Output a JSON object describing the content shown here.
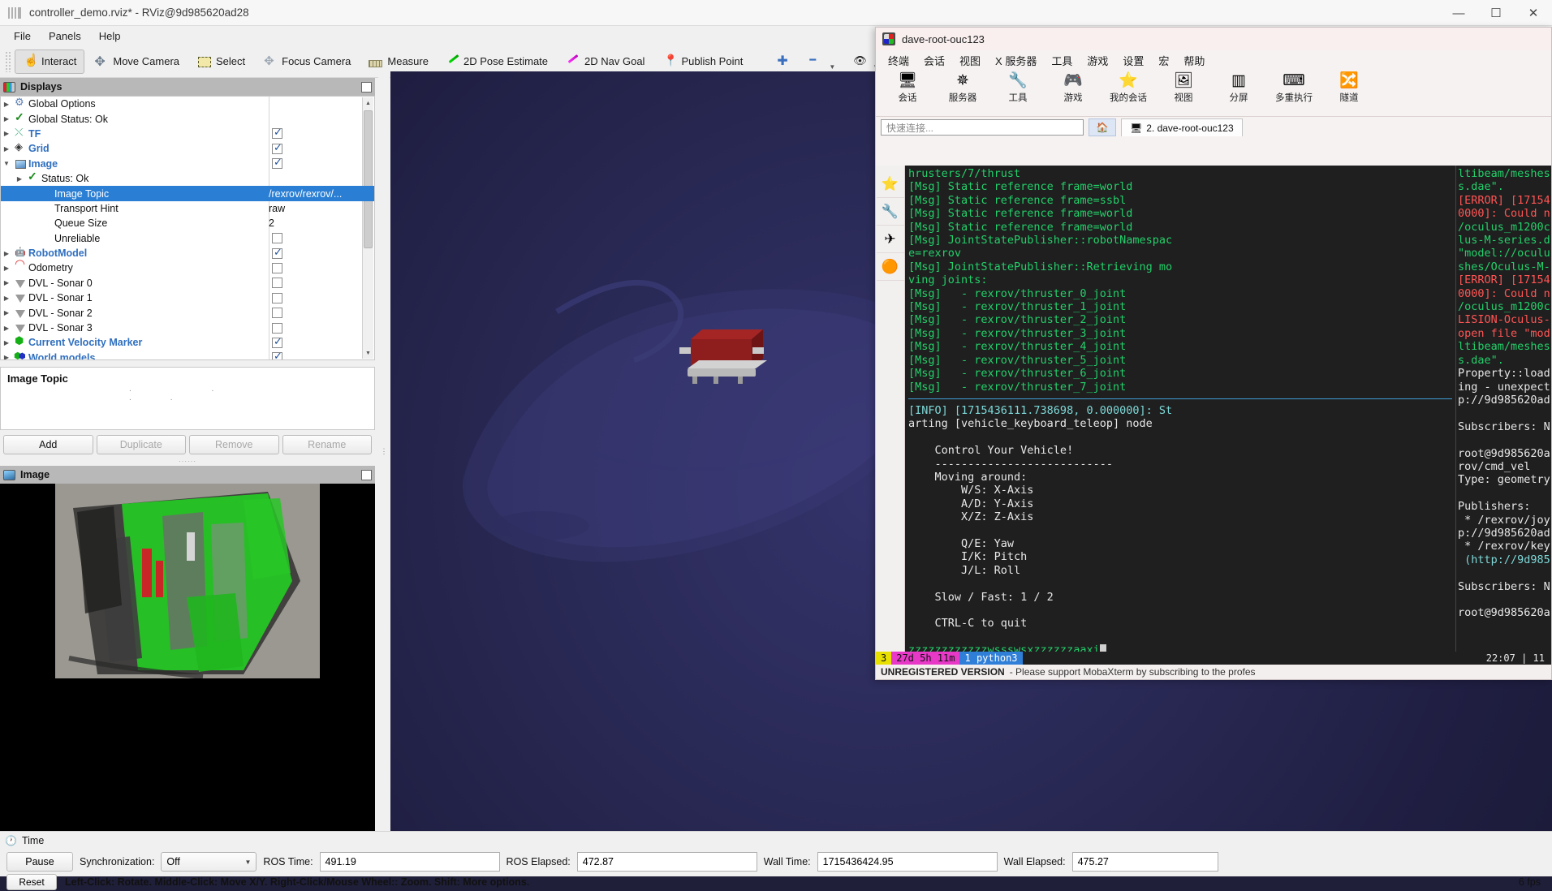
{
  "rviz": {
    "title": "controller_demo.rviz* - RViz@9d985620ad28",
    "window_buttons": {
      "minimize": "—",
      "maximize": "☐",
      "close": "✕"
    },
    "menu": [
      {
        "label": "File"
      },
      {
        "label": "Panels"
      },
      {
        "label": "Help"
      }
    ],
    "toolbar": [
      {
        "label": "Interact",
        "icon": "hand-icon",
        "active": true
      },
      {
        "label": "Move Camera",
        "icon": "move-camera-icon",
        "active": false
      },
      {
        "label": "Select",
        "icon": "select-icon",
        "active": false
      },
      {
        "label": "Focus Camera",
        "icon": "focus-camera-icon",
        "active": false
      },
      {
        "label": "Measure",
        "icon": "measure-icon",
        "active": false
      },
      {
        "label": "2D Pose Estimate",
        "icon": "pose-estimate-icon",
        "active": false
      },
      {
        "label": "2D Nav Goal",
        "icon": "nav-goal-icon",
        "active": false
      },
      {
        "label": "Publish Point",
        "icon": "publish-point-icon",
        "active": false
      }
    ],
    "toolbar_extra": [
      {
        "icon": "plus-icon",
        "label": ""
      },
      {
        "icon": "minus-icon",
        "label": ""
      },
      {
        "icon": "eye-icon",
        "label": ""
      }
    ],
    "displays_panel": {
      "title": "Displays",
      "rows": [
        {
          "indent": 0,
          "arrow": "closed",
          "icon": "gear-icon",
          "label": "Global Options",
          "bold": false,
          "value": "",
          "check": null,
          "selected": false
        },
        {
          "indent": 0,
          "arrow": "closed",
          "icon": "check-icon",
          "label": "Global Status: Ok",
          "bold": false,
          "value": "",
          "check": null,
          "selected": false
        },
        {
          "indent": 0,
          "arrow": "closed",
          "icon": "tf-icon",
          "label": "TF",
          "bold": true,
          "value": "",
          "check": true,
          "selected": false
        },
        {
          "indent": 0,
          "arrow": "closed",
          "icon": "grid-icon",
          "label": "Grid",
          "bold": true,
          "value": "",
          "check": true,
          "selected": false
        },
        {
          "indent": 0,
          "arrow": "open",
          "icon": "image-icon",
          "label": "Image",
          "bold": true,
          "value": "",
          "check": true,
          "selected": false
        },
        {
          "indent": 1,
          "arrow": "closed",
          "icon": "check-icon",
          "label": "Status: Ok",
          "bold": false,
          "value": "",
          "check": null,
          "selected": false
        },
        {
          "indent": 2,
          "arrow": "none",
          "icon": "none",
          "label": "Image Topic",
          "bold": false,
          "value": "/rexrov/rexrov/...",
          "check": null,
          "selected": true
        },
        {
          "indent": 2,
          "arrow": "none",
          "icon": "none",
          "label": "Transport Hint",
          "bold": false,
          "value": "raw",
          "check": null,
          "selected": false
        },
        {
          "indent": 2,
          "arrow": "none",
          "icon": "none",
          "label": "Queue Size",
          "bold": false,
          "value": "2",
          "check": null,
          "selected": false
        },
        {
          "indent": 2,
          "arrow": "none",
          "icon": "none",
          "label": "Unreliable",
          "bold": false,
          "value": "",
          "check": false,
          "selected": false
        },
        {
          "indent": 0,
          "arrow": "closed",
          "icon": "robot-icon",
          "label": "RobotModel",
          "bold": true,
          "value": "",
          "check": true,
          "selected": false
        },
        {
          "indent": 0,
          "arrow": "closed",
          "icon": "odometry-icon",
          "label": "Odometry",
          "bold": false,
          "value": "",
          "check": false,
          "selected": false
        },
        {
          "indent": 0,
          "arrow": "closed",
          "icon": "sonar-icon",
          "label": "DVL - Sonar 0",
          "bold": false,
          "value": "",
          "check": false,
          "selected": false
        },
        {
          "indent": 0,
          "arrow": "closed",
          "icon": "sonar-icon",
          "label": "DVL - Sonar 1",
          "bold": false,
          "value": "",
          "check": false,
          "selected": false
        },
        {
          "indent": 0,
          "arrow": "closed",
          "icon": "sonar-icon",
          "label": "DVL - Sonar 2",
          "bold": false,
          "value": "",
          "check": false,
          "selected": false
        },
        {
          "indent": 0,
          "arrow": "closed",
          "icon": "sonar-icon",
          "label": "DVL - Sonar 3",
          "bold": false,
          "value": "",
          "check": false,
          "selected": false
        },
        {
          "indent": 0,
          "arrow": "closed",
          "icon": "cube-icon",
          "label": "Current Velocity Marker",
          "bold": true,
          "value": "",
          "check": true,
          "selected": false
        },
        {
          "indent": 0,
          "arrow": "closed",
          "icon": "world-icon",
          "label": "World models",
          "bold": true,
          "value": "",
          "check": true,
          "selected": false
        }
      ],
      "property_title": "Image Topic",
      "buttons": [
        {
          "label": "Add",
          "enabled": true
        },
        {
          "label": "Duplicate",
          "enabled": false
        },
        {
          "label": "Remove",
          "enabled": false
        },
        {
          "label": "Rename",
          "enabled": false
        }
      ]
    },
    "image_panel": {
      "title": "Image"
    },
    "time_panel": {
      "title": "Time",
      "pause_label": "Pause",
      "sync_label": "Synchronization:",
      "sync_value": "Off",
      "ros_time_label": "ROS Time:",
      "ros_time_value": "491.19",
      "ros_elapsed_label": "ROS Elapsed:",
      "ros_elapsed_value": "472.87",
      "wall_time_label": "Wall Time:",
      "wall_time_value": "1715436424.95",
      "wall_elapsed_label": "Wall Elapsed:",
      "wall_elapsed_value": "475.27",
      "reset_label": "Reset",
      "hint": "Left-Click: Rotate.  Middle-Click: Move X/Y.  Right-Click/Mouse Wheel:: Zoom.  Shift: More options.",
      "fps": "6 fps"
    }
  },
  "moba": {
    "title": "dave-root-ouc123",
    "menu": [
      "终端",
      "会话",
      "视图",
      "X 服务器",
      "工具",
      "游戏",
      "设置",
      "宏",
      "帮助"
    ],
    "toolbar": [
      {
        "label": "会话",
        "icon": "session-icon"
      },
      {
        "label": "服务器",
        "icon": "servers-icon"
      },
      {
        "label": "工具",
        "icon": "tools-icon"
      },
      {
        "label": "游戏",
        "icon": "games-icon"
      },
      {
        "label": "我的会话",
        "icon": "sessions-icon"
      },
      {
        "label": "视图",
        "icon": "view-icon"
      },
      {
        "label": "分屏",
        "icon": "split-icon"
      },
      {
        "label": "多重执行",
        "icon": "multiexec-icon"
      },
      {
        "label": "隧道",
        "icon": "tunnel-icon"
      }
    ],
    "quick_connect_placeholder": "快速连接...",
    "home_tab_icon": "home-icon",
    "tab_label": "2. dave-root-ouc123",
    "sidebar": [
      "star-icon",
      "tools-icon",
      "sftp-icon",
      "macro-icon"
    ],
    "terminal_left": [
      {
        "text": "hrusters/7/thrust",
        "color": "green"
      },
      {
        "text": "[Msg] Static reference frame=world",
        "color": "green"
      },
      {
        "text": "[Msg] Static reference frame=ssbl",
        "color": "green"
      },
      {
        "text": "[Msg] Static reference frame=world",
        "color": "green"
      },
      {
        "text": "[Msg] Static reference frame=world",
        "color": "green"
      },
      {
        "text": "[Msg] JointStatePublisher::robotNamespac",
        "color": "green"
      },
      {
        "text": "e=rexrov",
        "color": "green"
      },
      {
        "text": "[Msg] JointStatePublisher::Retrieving mo",
        "color": "green"
      },
      {
        "text": "ving joints:",
        "color": "green"
      },
      {
        "text": "[Msg]   - rexrov/thruster_0_joint",
        "color": "green"
      },
      {
        "text": "[Msg]   - rexrov/thruster_1_joint",
        "color": "green"
      },
      {
        "text": "[Msg]   - rexrov/thruster_2_joint",
        "color": "green"
      },
      {
        "text": "[Msg]   - rexrov/thruster_3_joint",
        "color": "green"
      },
      {
        "text": "[Msg]   - rexrov/thruster_4_joint",
        "color": "green"
      },
      {
        "text": "[Msg]   - rexrov/thruster_5_joint",
        "color": "green"
      },
      {
        "text": "[Msg]   - rexrov/thruster_6_joint",
        "color": "green"
      },
      {
        "text": "[Msg]   - rexrov/thruster_7_joint",
        "color": "green"
      }
    ],
    "terminal_lower": [
      {
        "text": "[INFO] [1715436111.738698, 0.000000]: St",
        "color": "cyan"
      },
      {
        "text": "arting [vehicle_keyboard_teleop] node",
        "color": "white"
      },
      {
        "text": "",
        "color": "white"
      },
      {
        "text": "    Control Your Vehicle!",
        "color": "white"
      },
      {
        "text": "    ---------------------------",
        "color": "white"
      },
      {
        "text": "    Moving around:",
        "color": "white"
      },
      {
        "text": "        W/S: X-Axis",
        "color": "white"
      },
      {
        "text": "        A/D: Y-Axis",
        "color": "white"
      },
      {
        "text": "        X/Z: Z-Axis",
        "color": "white"
      },
      {
        "text": "",
        "color": "white"
      },
      {
        "text": "        Q/E: Yaw",
        "color": "white"
      },
      {
        "text": "        I/K: Pitch",
        "color": "white"
      },
      {
        "text": "        J/L: Roll",
        "color": "white"
      },
      {
        "text": "",
        "color": "white"
      },
      {
        "text": "    Slow / Fast: 1 / 2",
        "color": "white"
      },
      {
        "text": "",
        "color": "white"
      },
      {
        "text": "    CTRL-C to quit",
        "color": "white"
      },
      {
        "text": "",
        "color": "white"
      },
      {
        "text": "zzzzzzzzzzzzwssswsxzzzzzzaaxi",
        "color": "green"
      }
    ],
    "terminal_right": [
      {
        "text": "ltibeam/meshes",
        "color": "green"
      },
      {
        "text": "s.dae\".",
        "color": "green"
      },
      {
        "text": "[ERROR] [17154",
        "color": "red"
      },
      {
        "text": "0000]: Could n",
        "color": "red"
      },
      {
        "text": "/oculus_m1200c",
        "color": "green"
      },
      {
        "text": "lus-M-series.d",
        "color": "green"
      },
      {
        "text": "\"model://oculu",
        "color": "green"
      },
      {
        "text": "shes/Oculus-M-",
        "color": "green"
      },
      {
        "text": "[ERROR] [17154",
        "color": "red"
      },
      {
        "text": "0000]: Could n",
        "color": "red"
      },
      {
        "text": "/oculus_m1200c",
        "color": "green"
      },
      {
        "text": "LISION-Oculus-",
        "color": "red"
      },
      {
        "text": "open file \"mod",
        "color": "red"
      },
      {
        "text": "ltibeam/meshes",
        "color": "green"
      },
      {
        "text": "s.dae\".",
        "color": "green"
      },
      {
        "text": "Property::load",
        "color": "white"
      },
      {
        "text": "ing - unexpect",
        "color": "white"
      }
    ],
    "terminal_right_lower": [
      {
        "text": "p://9d985620ad",
        "color": "white"
      },
      {
        "text": "",
        "color": "white"
      },
      {
        "text": "Subscribers: N",
        "color": "white"
      },
      {
        "text": "",
        "color": "white"
      },
      {
        "text": "root@9d985620a",
        "color": "white"
      },
      {
        "text": "rov/cmd_vel",
        "color": "white"
      },
      {
        "text": "Type: geometry",
        "color": "white"
      },
      {
        "text": "",
        "color": "white"
      },
      {
        "text": "Publishers:",
        "color": "white"
      },
      {
        "text": " * /rexrov/joy",
        "color": "white"
      },
      {
        "text": "p://9d985620ad",
        "color": "white"
      },
      {
        "text": " * /rexrov/key",
        "color": "white"
      },
      {
        "text": " (http://9d985",
        "color": "cyan"
      },
      {
        "text": "",
        "color": "white"
      },
      {
        "text": "Subscribers: N",
        "color": "white"
      },
      {
        "text": "",
        "color": "white"
      },
      {
        "text": "root@9d985620a",
        "color": "white"
      }
    ],
    "status": {
      "count": "3",
      "uptime": "27d 5h 11m",
      "proc_num": "1",
      "proc_name": "python3",
      "clock": "22:07",
      "right_extra": "| 11"
    },
    "footer": {
      "unregistered": "UNREGISTERED VERSION",
      "note": "-  Please support MobaXterm by subscribing to the profes"
    }
  }
}
